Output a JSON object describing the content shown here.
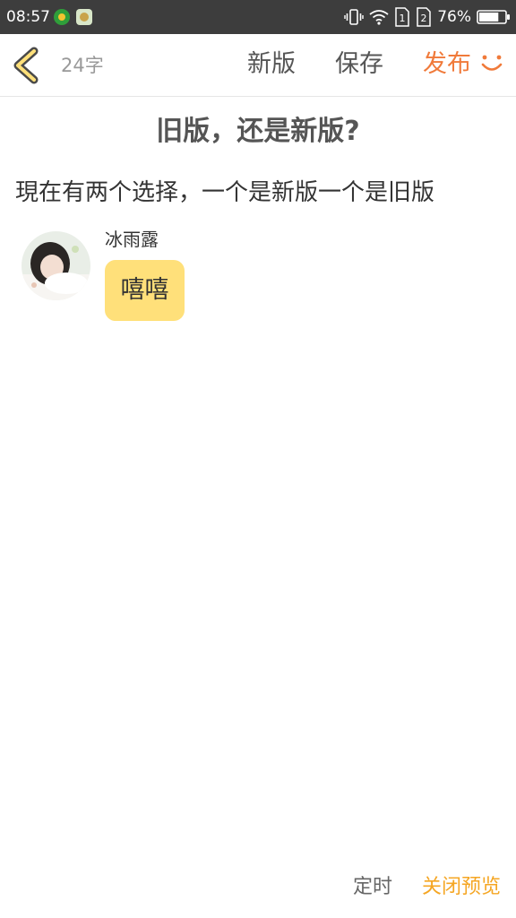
{
  "status_bar": {
    "time": "08:57",
    "battery_percent": "76%",
    "battery_level": 0.76,
    "sim1_label": "1",
    "sim2_label": "2",
    "icons": [
      "app-notification-icon",
      "app-notification-icon",
      "vibrate-icon",
      "wifi-icon",
      "sim-1-icon",
      "sim-2-icon",
      "battery-icon"
    ]
  },
  "toolbar": {
    "word_count": "24字",
    "new_version_label": "新版",
    "save_label": "保存",
    "publish_label": "发布",
    "icons": [
      "back-arrow-icon",
      "smile-icon"
    ]
  },
  "post": {
    "title": "旧版，还是新版?",
    "body": "現在有两个选择，一个是新版一个是旧版"
  },
  "chat": {
    "name": "冰雨露",
    "message": "嘻嘻"
  },
  "bottom": {
    "schedule_label": "定时",
    "close_preview_label": "关闭预览"
  },
  "colors": {
    "accent_orange": "#f07a3a",
    "bubble_yellow": "#ffe07a",
    "close_preview_yellow": "#f5a623",
    "status_bar_bg": "#3d3d3d"
  }
}
